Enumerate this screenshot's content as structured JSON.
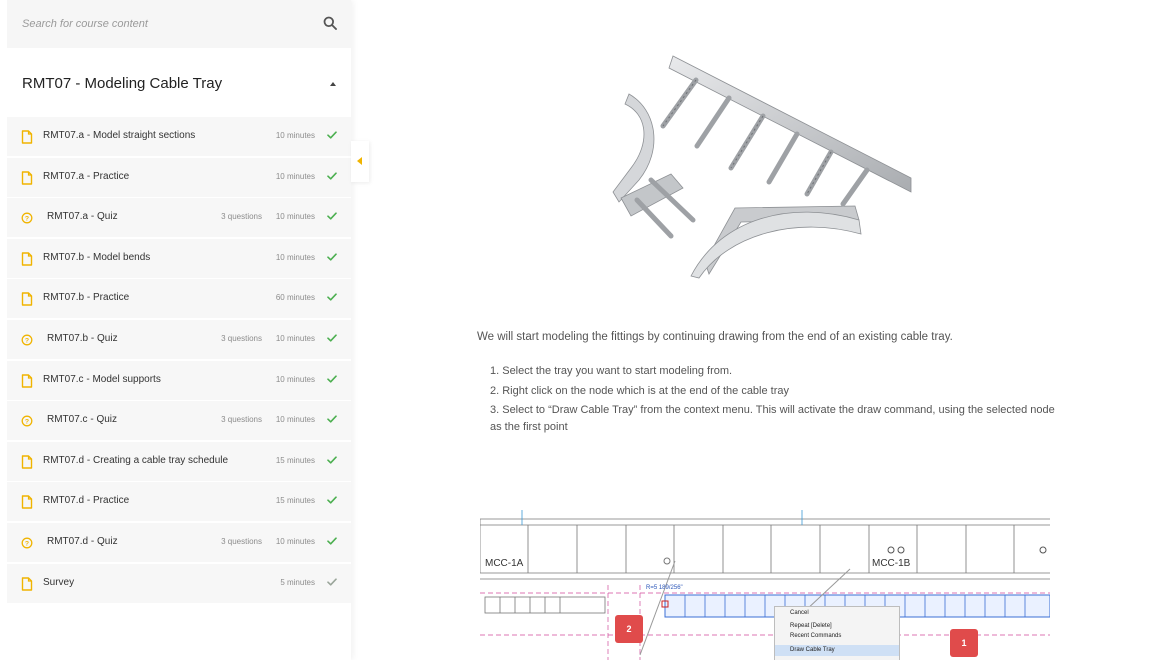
{
  "search": {
    "placeholder": "Search for course content"
  },
  "module": {
    "title": "RMT07 - Modeling Cable Tray"
  },
  "lessons": [
    {
      "title": "RMT07.a - Model straight sections",
      "questions": "",
      "duration": "10 minutes",
      "type": "doc"
    },
    {
      "title": "RMT07.a - Practice",
      "questions": "",
      "duration": "10 minutes",
      "type": "doc"
    },
    {
      "title": "RMT07.a - Quiz",
      "questions": "3 questions",
      "duration": "10 minutes",
      "type": "quiz"
    },
    {
      "title": "RMT07.b - Model bends",
      "questions": "",
      "duration": "10 minutes",
      "type": "doc"
    },
    {
      "title": "RMT07.b - Practice",
      "questions": "",
      "duration": "60 minutes",
      "type": "doc"
    },
    {
      "title": "RMT07.b - Quiz",
      "questions": "3 questions",
      "duration": "10 minutes",
      "type": "quiz"
    },
    {
      "title": "RMT07.c - Model supports",
      "questions": "",
      "duration": "10 minutes",
      "type": "doc"
    },
    {
      "title": "RMT07.c - Quiz",
      "questions": "3 questions",
      "duration": "10 minutes",
      "type": "quiz"
    },
    {
      "title": "RMT07.d - Creating a cable tray schedule",
      "questions": "",
      "duration": "15 minutes",
      "type": "doc"
    },
    {
      "title": "RMT07.d - Practice",
      "questions": "",
      "duration": "15 minutes",
      "type": "doc"
    },
    {
      "title": "RMT07.d - Quiz",
      "questions": "3 questions",
      "duration": "10 minutes",
      "type": "quiz"
    },
    {
      "title": "Survey",
      "questions": "",
      "duration": "5 minutes",
      "type": "doc",
      "check_color": "#9aa59a"
    }
  ],
  "content": {
    "intro": "We will start modeling the fittings by continuing drawing from the end of an existing cable tray.",
    "steps": [
      "1. Select the tray you want to start modeling from.",
      "2. Right click on the node which is at the end of the cable tray",
      "3. Select to “Draw Cable Tray” from the context menu. This will activate the draw command, using the selected node"
    ],
    "step3_cont": "as the first point"
  },
  "cad": {
    "labels": {
      "mcc1a": "MCC-1A",
      "mcc1b": "MCC-1B",
      "dim": "R=5 189/256\""
    },
    "context_menu": [
      "Cancel",
      "Repeat [Delete]",
      "Recent Commands",
      "Draw Cable Tray"
    ],
    "badges": [
      "2",
      "1"
    ]
  },
  "colors": {
    "accent": "#f0b400",
    "check": "#4caf50",
    "badge": "#e04b4b"
  }
}
